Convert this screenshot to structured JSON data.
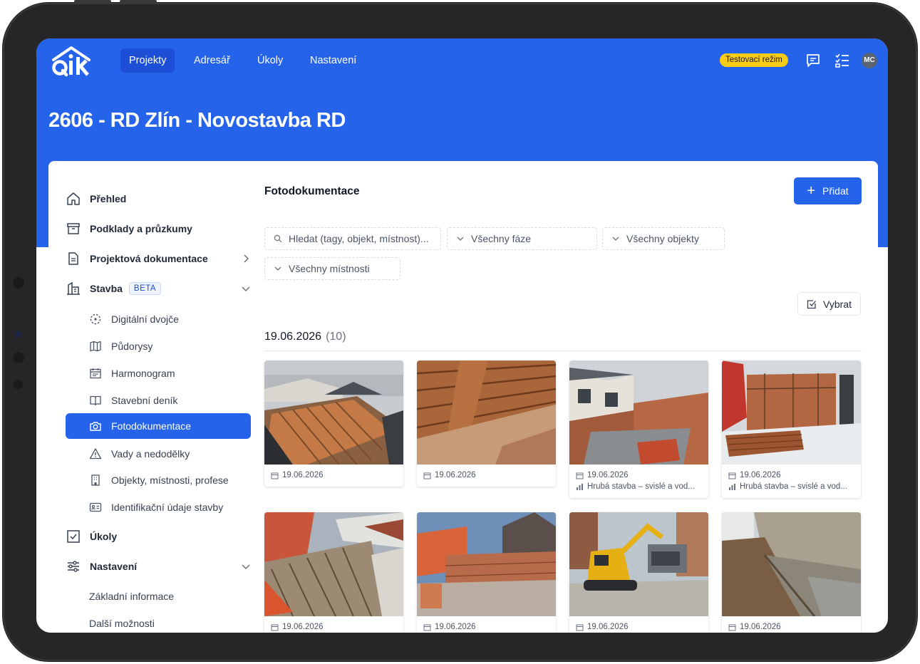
{
  "nav": {
    "items": [
      {
        "label": "Projekty",
        "active": true
      },
      {
        "label": "Adresář"
      },
      {
        "label": "Úkoly"
      },
      {
        "label": "Nastavení"
      }
    ],
    "test_mode": "Testovací režim",
    "avatar_initials": "MC",
    "icons": [
      "chat-icon",
      "checklist-icon"
    ]
  },
  "project": {
    "title": "2606 - RD Zlín - Novostavba RD"
  },
  "sidebar": {
    "items": [
      {
        "label": "Přehled",
        "icon": "home-icon"
      },
      {
        "label": "Podklady a průzkumy",
        "icon": "archive-icon"
      },
      {
        "label": "Projektová dokumentace",
        "icon": "document-icon"
      },
      {
        "label": "Stavba",
        "icon": "building-icon",
        "badge": "BETA"
      },
      {
        "label": "Úkoly",
        "icon": "checkbox-icon"
      },
      {
        "label": "Nastavení",
        "icon": "sliders-icon"
      }
    ],
    "stavba_sub": [
      {
        "label": "Digitální dvojče",
        "icon": "digital-twin-icon"
      },
      {
        "label": "Půdorysy",
        "icon": "map-icon"
      },
      {
        "label": "Harmonogram",
        "icon": "calendar-icon"
      },
      {
        "label": "Stavební deník",
        "icon": "book-icon"
      },
      {
        "label": "Fotodokumentace",
        "icon": "camera-icon",
        "active": true
      },
      {
        "label": "Vady a nedodělky",
        "icon": "warning-icon"
      },
      {
        "label": "Objekty, místnosti, profese",
        "icon": "building-small-icon"
      },
      {
        "label": "Identifikační údaje stavby",
        "icon": "id-card-icon"
      }
    ],
    "nastaveni_sub": [
      {
        "label": "Základní informace"
      },
      {
        "label": "Další možnosti"
      }
    ]
  },
  "main": {
    "title": "Fotodokumentace",
    "add_label": "Přidat",
    "search_placeholder": "Hledat (tagy, objekt, místnost)...",
    "filters": [
      "Všechny fáze",
      "Všechny objekty",
      "Všechny místnosti"
    ],
    "select_label": "Vybrat",
    "group": {
      "date": "19.06.2026",
      "count": "(10)"
    },
    "photos": [
      {
        "date": "19.06.2026",
        "phase": ""
      },
      {
        "date": "19.06.2026",
        "phase": ""
      },
      {
        "date": "19.06.2026",
        "phase": "Hrubá stavba – svislé a vod..."
      },
      {
        "date": "19.06.2026",
        "phase": "Hrubá stavba – svislé a vod..."
      },
      {
        "date": "19.06.2026",
        "phase": ""
      },
      {
        "date": "19.06.2026",
        "phase": ""
      },
      {
        "date": "19.06.2026",
        "phase": ""
      },
      {
        "date": "19.06.2026",
        "phase": ""
      }
    ]
  },
  "colors": {
    "primary": "#2563eb",
    "badge": "#facc15"
  }
}
